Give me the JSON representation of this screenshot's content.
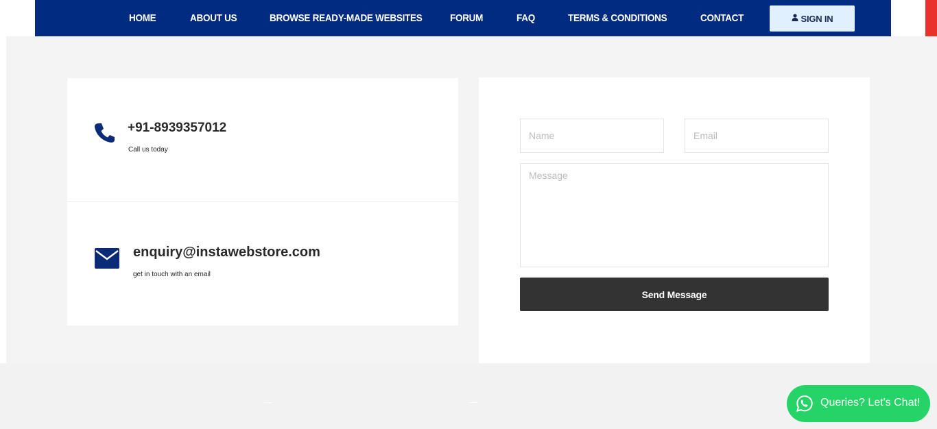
{
  "nav": {
    "items": [
      "HOME",
      "ABOUT US",
      "BROWSE READY-MADE WEBSITES",
      "FORUM",
      "FAQ",
      "TERMS & CONDITIONS",
      "CONTACT"
    ],
    "signin_label": "SIGN IN",
    "signin_icon": "user-icon"
  },
  "contact_info": {
    "phone": "+91-8939357012",
    "phone_caption": "Call us today",
    "phone_icon": "phone-icon",
    "email": "enquiry@instawebstore.com",
    "email_caption": "get in touch with an email",
    "email_icon": "envelope-icon"
  },
  "form": {
    "name_placeholder": "Name",
    "email_placeholder": "Email",
    "message_placeholder": "Message",
    "send_label": "Send Message"
  },
  "chat": {
    "label": "Queries? Let's Chat!",
    "icon": "whatsapp-icon"
  },
  "colors": {
    "nav_bg": "#012a81",
    "accent_icon": "#0b2a78",
    "signin_bg": "#e0f0ff",
    "button_dark": "#333333",
    "chat_green": "#25d366",
    "red_strip": "#e8322b"
  }
}
